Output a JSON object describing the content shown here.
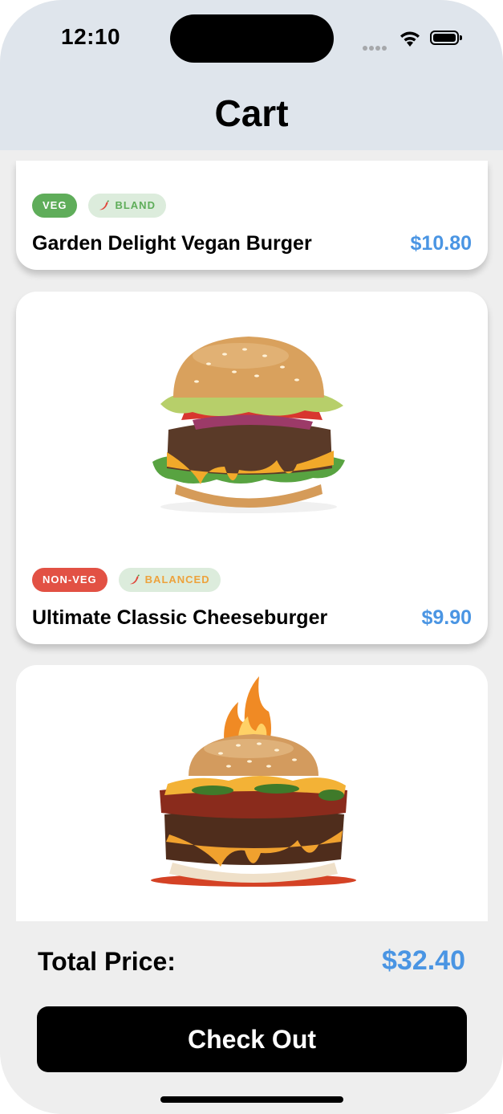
{
  "status_bar": {
    "time": "12:10"
  },
  "header": {
    "title": "Cart"
  },
  "items": [
    {
      "diet": "VEG",
      "taste": "BLAND",
      "name": "Garden Delight Vegan Burger",
      "price": "$10.80",
      "image_icon": "vegan-burger-image"
    },
    {
      "diet": "NON-VEG",
      "taste": "BALANCED",
      "name": "Ultimate Classic Cheeseburger",
      "price": "$9.90",
      "image_icon": "cheeseburger-image"
    },
    {
      "image_icon": "flaming-burger-image"
    }
  ],
  "footer": {
    "total_label": "Total Price:",
    "total_value": "$32.40",
    "checkout_label": "Check Out"
  },
  "colors": {
    "accent": "#4a95e3",
    "veg": "#5fad5a",
    "non_veg": "#e25144",
    "balanced": "#eda23c",
    "header_bg": "#dfe5ec"
  }
}
